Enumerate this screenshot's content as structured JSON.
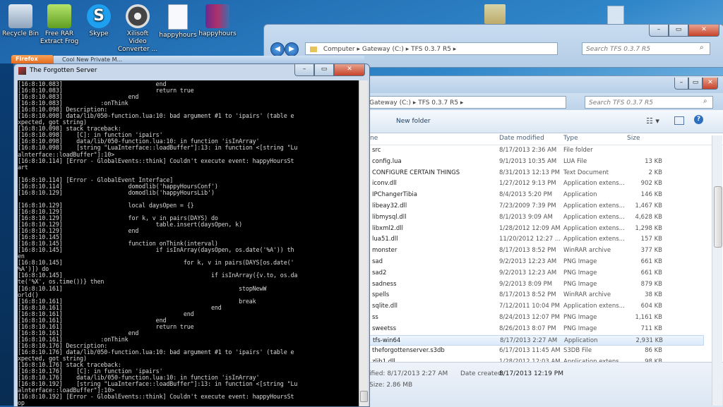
{
  "desktop": {
    "icons": [
      {
        "label": "Recycle Bin",
        "icon": "recycle-bin-icon",
        "color": "#9fb3c8"
      },
      {
        "label": "Free RAR Extract Frog",
        "icon": "frog-icon",
        "color": "#8cc63f"
      },
      {
        "label": "Skype",
        "icon": "skype-icon",
        "color": "#1ea0f0"
      },
      {
        "label": "Xilisoft Video Converter ...",
        "icon": "film-reel-icon",
        "color": "#555555"
      },
      {
        "label": "happyhours",
        "icon": "document-icon",
        "color": "#f3f6fa"
      },
      {
        "label": "happyhours",
        "icon": "winrar-icon",
        "color": "#8b2d7a"
      }
    ]
  },
  "explorer_back": {
    "breadcrumb": [
      "Computer",
      "Gateway (C:)",
      "TFS 0.3.7 R5"
    ],
    "search_placeholder": "Search TFS 0.3.7 R5",
    "buttons": {
      "minimize": "–",
      "maximize": "▭",
      "close": "✕"
    }
  },
  "firefox": {
    "tab_label": "Firefox",
    "strip_text": "Cool New Private M..."
  },
  "explorer_front": {
    "breadcrumb": [
      "Gateway (C:)",
      "TFS 0.3.7 R5"
    ],
    "search_placeholder": "Search TFS 0.3.7 R5",
    "new_folder_label": "New folder",
    "columns": {
      "name": "ne",
      "date": "Date modified",
      "type": "Type",
      "size": "Size"
    },
    "files": [
      {
        "name": "src",
        "date": "8/17/2013 2:36 AM",
        "type": "File folder",
        "size": ""
      },
      {
        "name": "config.lua",
        "date": "9/1/2013 10:35 AM",
        "type": "LUA File",
        "size": "13 KB"
      },
      {
        "name": "CONFIGURE CERTAIN THINGS",
        "date": "8/31/2013 12:13 PM",
        "type": "Text Document",
        "size": "2 KB"
      },
      {
        "name": "iconv.dll",
        "date": "1/27/2012 9:13 PM",
        "type": "Application extens...",
        "size": "902 KB"
      },
      {
        "name": "IPChangerTibia",
        "date": "8/4/2013 5:20 PM",
        "type": "Application",
        "size": "146 KB"
      },
      {
        "name": "libeay32.dll",
        "date": "7/23/2009 7:39 PM",
        "type": "Application extens...",
        "size": "1,467 KB"
      },
      {
        "name": "libmysql.dll",
        "date": "8/1/2013 9:09 AM",
        "type": "Application extens...",
        "size": "4,628 KB"
      },
      {
        "name": "libxml2.dll",
        "date": "1/28/2012 12:09 AM",
        "type": "Application extens...",
        "size": "1,298 KB"
      },
      {
        "name": "lua51.dll",
        "date": "11/20/2012 12:27 ...",
        "type": "Application extens...",
        "size": "157 KB"
      },
      {
        "name": "monster",
        "date": "8/17/2013 8:52 PM",
        "type": "WinRAR archive",
        "size": "377 KB"
      },
      {
        "name": "sad",
        "date": "9/2/2013 12:23 AM",
        "type": "PNG Image",
        "size": "661 KB"
      },
      {
        "name": "sad2",
        "date": "9/2/2013 12:23 AM",
        "type": "PNG Image",
        "size": "661 KB"
      },
      {
        "name": "sadness",
        "date": "9/2/2013 8:09 PM",
        "type": "PNG Image",
        "size": "879 KB"
      },
      {
        "name": "spells",
        "date": "8/17/2013 8:52 PM",
        "type": "WinRAR archive",
        "size": "38 KB"
      },
      {
        "name": "sqlite.dll",
        "date": "7/12/2011 10:04 PM",
        "type": "Application extens...",
        "size": "604 KB"
      },
      {
        "name": "ss",
        "date": "8/24/2013 12:07 PM",
        "type": "PNG Image",
        "size": "1,161 KB"
      },
      {
        "name": "sweetss",
        "date": "8/26/2013 8:07 PM",
        "type": "PNG Image",
        "size": "711 KB"
      },
      {
        "name": "tfs-win64",
        "date": "8/17/2013 2:27 AM",
        "type": "Application",
        "size": "2,931 KB",
        "selected": true
      },
      {
        "name": "theforgottenserver.s3db",
        "date": "6/17/2013 11:45 AM",
        "type": "S3DB File",
        "size": "86 KB"
      },
      {
        "name": "zlib1.dll",
        "date": "1/28/2012 12:03 AM",
        "type": "Application extens...",
        "size": "98 KB"
      }
    ],
    "details": {
      "modified": "ified: 8/17/2013 2:27 AM",
      "created_label": "Date created:",
      "created_value": "8/17/2013 12:19 PM",
      "size": "Size: 2.86 MB"
    }
  },
  "console": {
    "title": "The Forgotten Server",
    "buttons": {
      "minimize": "–",
      "maximize": "▭",
      "close": "✕"
    },
    "text": "[16:8:10.083]                           end\n[16:8:10.083]                           return true\n[16:8:10.083]                   end\n[16:8:10.083]           :onThink\n[16:8:10.098] Description:\n[16:8:10.098] data/lib/050-function.lua:10: bad argument #1 to 'ipairs' (table e\nxpected, got string)\n[16:8:10.098] stack traceback:\n[16:8:10.098]    [C]: in function 'ipairs'\n[16:8:10.098]    data/lib/050-function.lua:10: in function 'isInArray'\n[16:8:10.098]    [string \"LuaInterface::loadBuffer\"]:13: in function <[string \"Lu\nalnterface::loadBuffer\"]:10>\n[16:8:10.114] [Error - GlobalEvents::think] Couldn't execute event: happyHoursSt\nart\n\n[16:8:10.114] [Error - GlobalEvent Interface]\n[16:8:10.114]                   domodlib('happyHoursConf')\n[16:8:10.129]                   domodlib('happyHoursLib')\n\n[16:8:10.129]                   local daysOpen = {}\n[16:8:10.129]\n[16:8:10.129]                   for k, v in pairs(DAYS) do\n[16:8:10.129]                           table.insert(daysOpen, k)\n[16:8:10.129]                   end\n[16:8:10.145]\n[16:8:10.145]                   function onThink(interval)\n[16:8:10.145]                           if isInArray(daysOpen, os.date('%A')) th\nen\n[16:8:10.145]                                   for k, v in pairs(DAYS[os.date('\n%A')]) do\n[16:8:10.145]                                           if isInArray({v.to, os.da\nte('%X', os.time())} then\n[16:8:10.161]                                                   stopNewW\norld()\n[16:8:10.161]                                                   break\n[16:8:10.161]                                           end\n[16:8:10.161]                                   end\n[16:8:10.161]                           end\n[16:8:10.161]                           return true\n[16:8:10.161]                   end\n[16:8:10.161]           :onThink\n[16:8:10.176] Description:\n[16:8:10.176] data/lib/050-function.lua:10: bad argument #1 to 'ipairs' (table e\nxpected, got string)\n[16:8:10.176] stack traceback:\n[16:8:10.176]    [C]: in function 'ipairs'\n[16:8:10.176]    data/lib/050-function.lua:10: in function 'isInArray'\n[16:8:10.192]    [string \"LuaInterface::loadBuffer\"]:13: in function <[string \"Lu\nalnterface::loadBuffer\"]:10>\n[16:8:10.192] [Error - GlobalEvents::think] Couldn't execute event: happyHoursSt\nop"
  }
}
